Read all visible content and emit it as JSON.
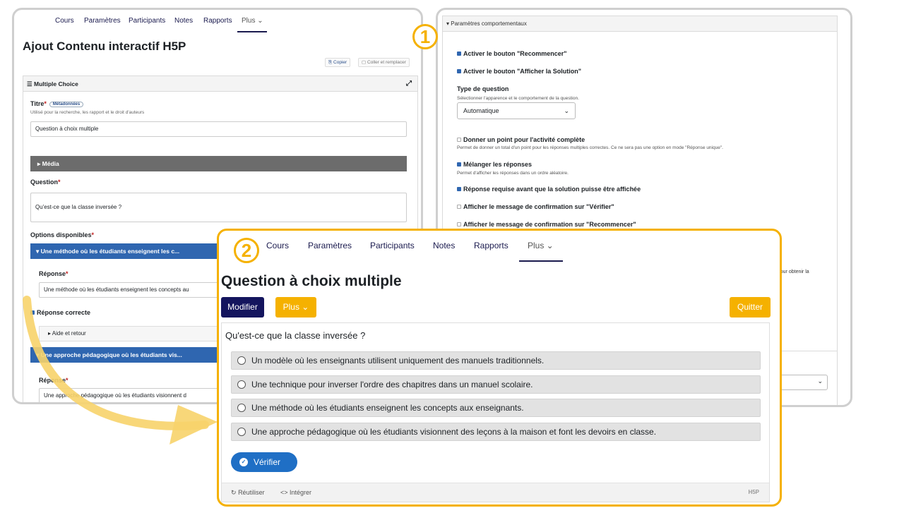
{
  "editor": {
    "nav": [
      "Cours",
      "Paramètres",
      "Participants",
      "Notes",
      "Rapports",
      "Plus ⌄"
    ],
    "title": "Ajout Contenu interactif H5P",
    "copy_label": "Copier",
    "paste_label": "Coller et remplacer",
    "box_title": "Multiple Choice",
    "titre_label": "Titre",
    "metadata_label": "Métadonnées",
    "titre_help": "Utilisé pour la recherche, les rapport et le droit d'auteurs",
    "titre_value": "Question à choix multiple",
    "media_label": "Média",
    "question_label": "Question",
    "question_value": "Qu'est-ce que la classe inversée ?",
    "options_label": "Options disponibles",
    "option1_bar": "Une méthode où les étudiants enseignent les c...",
    "reponse_label": "Réponse",
    "option1_value": "Une méthode où les étudiants enseignent les concepts au",
    "correct_label": "Réponse correcte",
    "aide_label": "Aide et retour",
    "option2_bar": "Une approche pédagogique où les étudiants vis...",
    "option2_value": "Une approche pédagogique où les étudiants visionnent d"
  },
  "settings": {
    "header": "Paramètres comportementaux",
    "retry": "Activer le bouton \"Recommencer\"",
    "solution": "Activer le bouton \"Afficher la Solution\"",
    "type_label": "Type de question",
    "type_help": "Sélectionner l'apparence et le comportement de la question.",
    "type_value": "Automatique",
    "single_point": "Donner un point pour l'activité complète",
    "single_point_help": "Permet de donner un total d'un point pour les réponses multiples correctes. Ce ne sera pas une option en mode \"Réponse unique\".",
    "shuffle": "Mélanger les réponses",
    "shuffle_help": "Permet d'afficher les réponses dans un ordre aléatoire.",
    "required": "Réponse requise avant que la solution puisse être affichée",
    "confirm_check": "Afficher le message de confirmation sur \"Vérifier\"",
    "confirm_retry": "Afficher le message de confirmation sur \"Recommencer\"",
    "trunc_text": ", pour obtenir la"
  },
  "badges": {
    "one": "1",
    "two": "2"
  },
  "preview": {
    "nav": [
      "Cours",
      "Paramètres",
      "Participants",
      "Notes",
      "Rapports",
      "Plus ⌄"
    ],
    "title": "Question à choix multiple",
    "modifier": "Modifier",
    "plus": "Plus ⌄",
    "quitter": "Quitter",
    "question": "Qu'est-ce que la classe inversée ?",
    "options": [
      "Un modèle où les enseignants utilisent uniquement des manuels traditionnels.",
      "Une technique pour inverser l'ordre des chapitres dans un manuel scolaire.",
      "Une méthode où les étudiants enseignent les concepts aux enseignants.",
      "Une approche pédagogique où les étudiants visionnent des leçons à la maison et font les devoirs en classe."
    ],
    "verify": "Vérifier",
    "reuse": "Réutiliser",
    "embed": "Intégrer",
    "logo": "H5P"
  },
  "colors": {
    "accent": "#f5b100",
    "navy": "#14155e",
    "blue": "#1f6fc5"
  }
}
